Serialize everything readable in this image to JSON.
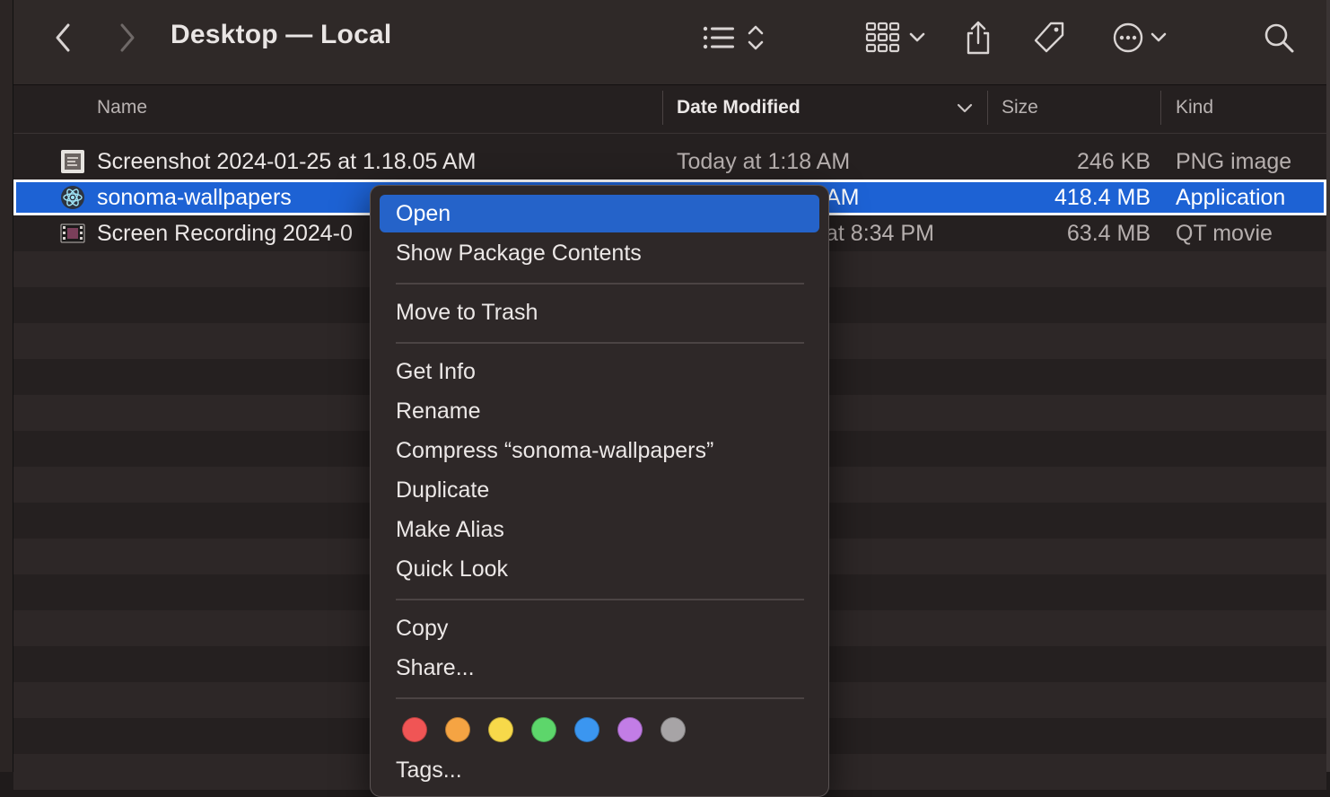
{
  "window": {
    "title": "Desktop — Local"
  },
  "toolbar": {
    "icons": [
      "back-icon",
      "forward-icon",
      "list-view-icon",
      "sort-icon",
      "grid-view-icon",
      "chevron-down-icon",
      "share-icon",
      "tag-icon",
      "more-icon",
      "search-icon"
    ]
  },
  "columns": {
    "name": "Name",
    "date": "Date Modified",
    "size": "Size",
    "kind": "Kind"
  },
  "files": [
    {
      "name": "Screenshot 2024-01-25 at 1.18.05 AM",
      "date": "Today at 1:18 AM",
      "size": "246 KB",
      "kind": "PNG image",
      "icon": "png-file-icon"
    },
    {
      "name": "sonoma-wallpapers",
      "date": "AM",
      "size": "418.4 MB",
      "kind": "Application",
      "icon": "app-icon"
    },
    {
      "name": "Screen Recording 2024-0",
      "date": "at 8:34 PM",
      "size": "63.4 MB",
      "kind": "QT movie",
      "icon": "movie-file-icon"
    }
  ],
  "context_menu": {
    "items": [
      "Open",
      "Show Package Contents",
      "Move to Trash",
      "Get Info",
      "Rename",
      "Compress “sonoma-wallpapers”",
      "Duplicate",
      "Make Alias",
      "Quick Look",
      "Copy",
      "Share...",
      "Tags..."
    ],
    "tag_colors": [
      "#f05555",
      "#f5a443",
      "#f7d94a",
      "#5dd66b",
      "#3b96f0",
      "#c27de6",
      "#a7a4a6"
    ]
  }
}
